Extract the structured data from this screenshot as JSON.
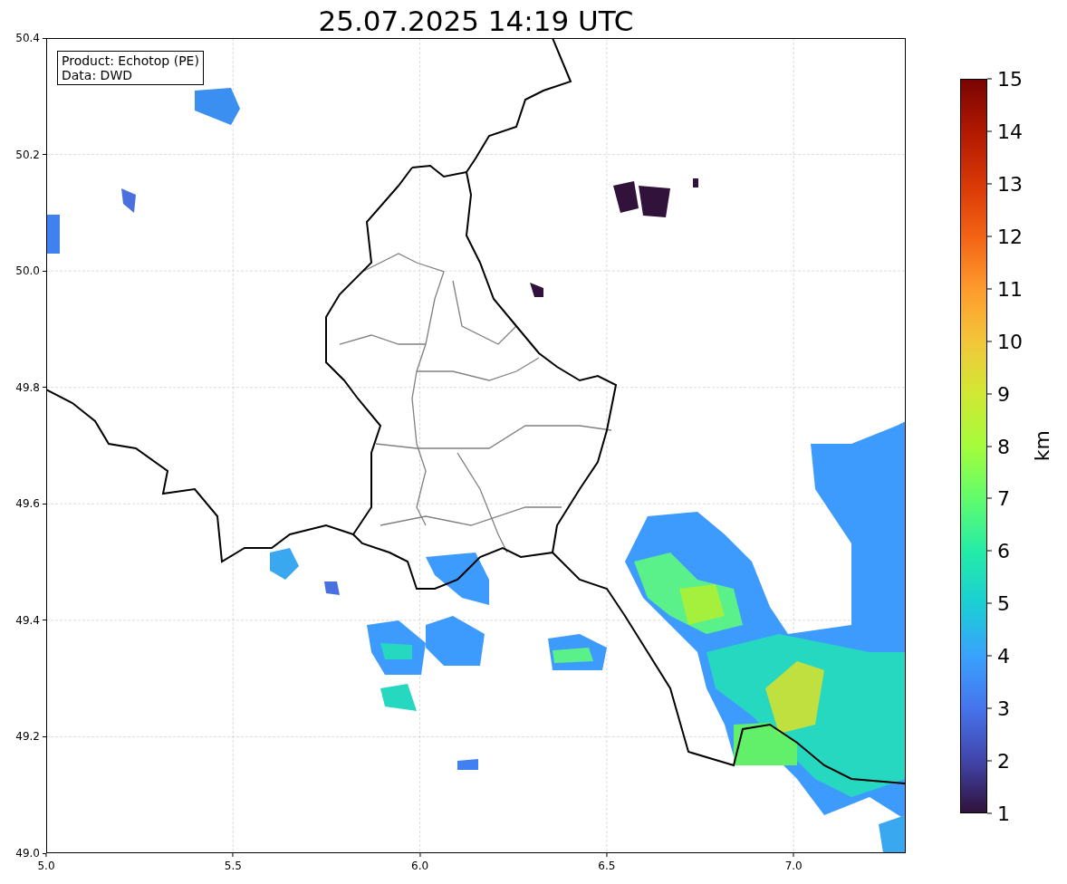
{
  "title": "25.07.2025 14:19 UTC",
  "info_box": [
    "Product: Echotop (PE)",
    "Data: DWD"
  ],
  "map": {
    "yticks": [
      "50.4",
      "50.2",
      "50.0",
      "49.8",
      "49.6",
      "49.4",
      "49.2",
      "49.0"
    ],
    "xticks": [
      "5.0",
      "5.5",
      "6.0",
      "6.5",
      "7.0"
    ]
  },
  "colorbar": {
    "label": "km",
    "ticks": [
      "15",
      "14",
      "13",
      "12",
      "11",
      "10",
      "9",
      "8",
      "7",
      "6",
      "5",
      "4",
      "3",
      "2",
      "1"
    ]
  }
}
